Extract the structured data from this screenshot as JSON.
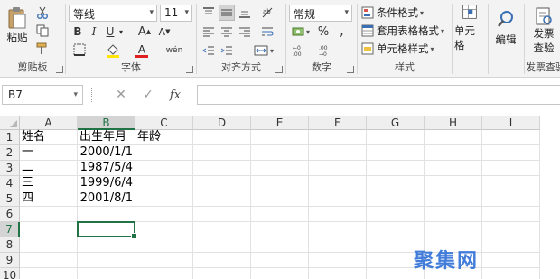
{
  "ribbon": {
    "clipboard": {
      "paste_label": "粘贴",
      "group_label": "剪贴板"
    },
    "font": {
      "font_name": "等线",
      "font_size": "11",
      "group_label": "字体",
      "bold": "B",
      "italic": "I",
      "underline": "U",
      "grow": "A",
      "shrink": "A",
      "font_color_letter": "A",
      "phonetic": "wén"
    },
    "alignment": {
      "group_label": "对齐方式"
    },
    "number": {
      "format": "常规",
      "group_label": "数字",
      "percent": "%",
      "comma": ","
    },
    "styles": {
      "conditional": "条件格式",
      "table": "套用表格格式",
      "cell_styles": "单元格样式",
      "group_label": "样式"
    },
    "cells": {
      "label": "单元格"
    },
    "editing": {
      "label": "编辑"
    },
    "invoice": {
      "label_line1": "发票",
      "label_line2": "查验",
      "group_label": "发票查验"
    }
  },
  "formula_bar": {
    "name_box": "B7",
    "cancel": "✕",
    "enter": "✓",
    "fx": "fx",
    "value": ""
  },
  "sheet": {
    "columns": [
      "A",
      "B",
      "C",
      "D",
      "E",
      "F",
      "G",
      "H",
      "I"
    ],
    "rows": [
      "1",
      "2",
      "3",
      "4",
      "5",
      "6",
      "7",
      "8",
      "9",
      "10"
    ],
    "active_cell": "B7",
    "cells": {
      "A1": "姓名",
      "B1": "出生年月",
      "C1": "年龄",
      "A2": "一",
      "B2": "2000/1/1",
      "A3": "二",
      "B3": "1987/5/4",
      "A4": "三",
      "B4": "1999/6/4",
      "A5": "四",
      "B5": "2001/8/1"
    }
  },
  "watermark": "聚集网",
  "colors": {
    "accent": "#217346",
    "ribbon_bg": "#f3f3f3",
    "header_bg": "#efefef",
    "watermark": "#2f6fd6"
  }
}
